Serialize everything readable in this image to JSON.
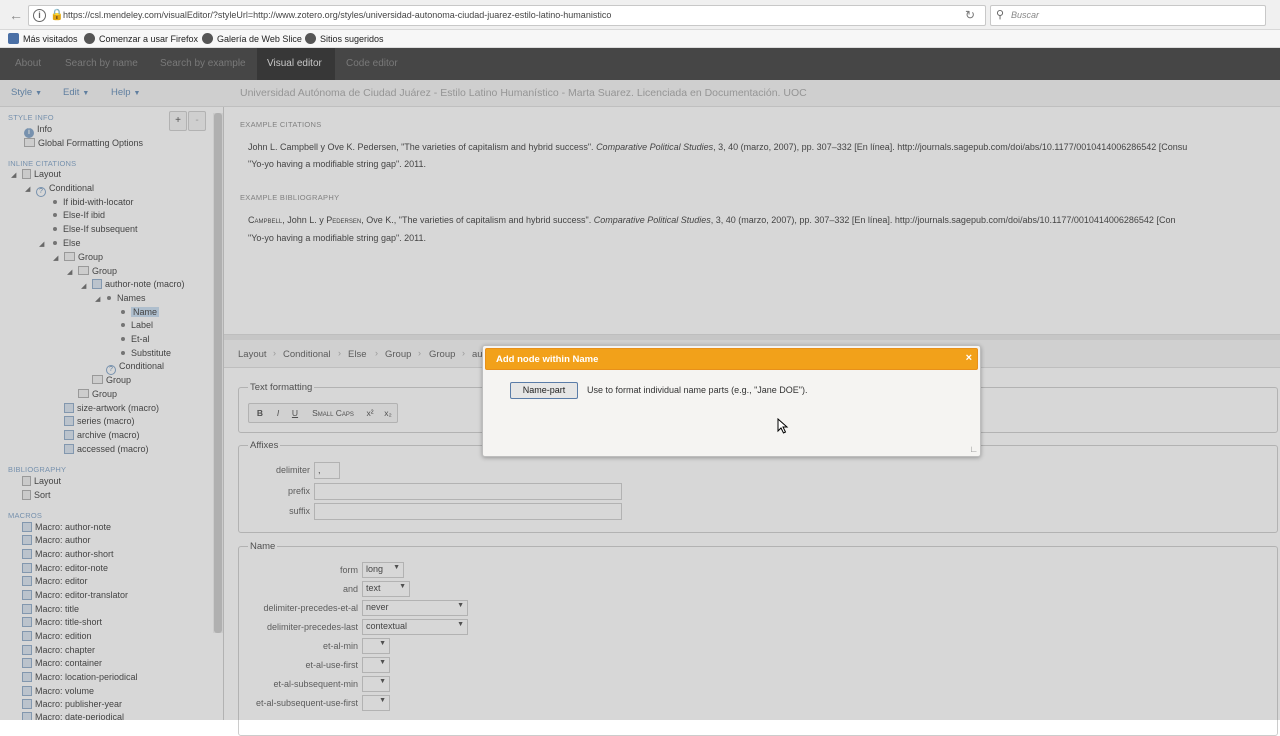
{
  "browser": {
    "url": "https://csl.mendeley.com/visualEditor/?styleUrl=http://www.zotero.org/styles/universidad-autonoma-ciudad-juarez-estilo-latino-humanistico",
    "search_placeholder": "Buscar",
    "bookmarks": [
      "Más visitados",
      "Comenzar a usar Firefox",
      "Galería de Web Slice",
      "Sitios sugeridos"
    ]
  },
  "nav": {
    "items": [
      "About",
      "Search by name",
      "Search by example",
      "Visual editor",
      "Code editor"
    ],
    "active": "Visual editor"
  },
  "menubar": {
    "menus": [
      "Style",
      "Edit",
      "Help"
    ],
    "style_title": "Universidad Autónoma de Ciudad Juárez - Estilo Latino Humanístico - Marta Suarez. Licenciada en Documentación. UOC"
  },
  "sidebar": {
    "add_label": "+",
    "remove_label": "-",
    "style_info_head": "STYLE INFO",
    "info": "Info",
    "global_formatting": "Global Formatting Options",
    "inline_head": "INLINE CITATIONS",
    "inline_nodes": [
      "Layout",
      "Conditional",
      "If ibid-with-locator",
      "Else-If ibid",
      "Else-If subsequent",
      "Else",
      "Group",
      "Group",
      "author-note (macro)",
      "Names",
      "Name",
      "Label",
      "Et-al",
      "Substitute",
      "Conditional",
      "Group",
      "Group",
      "size-artwork (macro)",
      "series (macro)",
      "archive (macro)",
      "accessed (macro)"
    ],
    "bibliography_head": "BIBLIOGRAPHY",
    "bib_nodes": [
      "Layout",
      "Sort"
    ],
    "macros_head": "MACROS",
    "macros": [
      "Macro: author-note",
      "Macro: author",
      "Macro: author-short",
      "Macro: editor-note",
      "Macro: editor",
      "Macro: editor-translator",
      "Macro: title",
      "Macro: title-short",
      "Macro: edition",
      "Macro: chapter",
      "Macro: container",
      "Macro: location-periodical",
      "Macro: volume",
      "Macro: publisher-year",
      "Macro: date-periodical"
    ]
  },
  "preview": {
    "citations_head": "EXAMPLE CITATIONS",
    "citation_1_a": "John L. Campbell y Ove K. Pedersen, \"The varieties of capitalism and hybrid success\". ",
    "citation_1_i": "Comparative Political Studies",
    "citation_1_b": ", 3, 40 (marzo, 2007), pp. 307–332 [En línea]. http://journals.sagepub.com/doi/abs/10.1177/0010414006286542 [Consu",
    "citation_2": "\"Yo-yo having a modifiable string gap\". 2011.",
    "bibliography_head": "EXAMPLE BIBLIOGRAPHY",
    "bib_1_sc1": "Campbell",
    "bib_1_a": ", John L. y ",
    "bib_1_sc2": "Pedersen",
    "bib_1_b": ", Ove K., \"The varieties of capitalism and hybrid success\". ",
    "bib_1_i": "Comparative Political Studies",
    "bib_1_c": ", 3, 40 (marzo, 2007), pp. 307–332 [En línea]. http://journals.sagepub.com/doi/abs/10.1177/0010414006286542 [Con",
    "bib_2": "\"Yo-yo having a modifiable string gap\". 2011."
  },
  "breadcrumb": [
    "Layout",
    "Conditional",
    "Else",
    "Group",
    "Group",
    "au"
  ],
  "editor": {
    "text_formatting": "Text formatting",
    "fmt_buttons": [
      "B",
      "I",
      "U",
      "Small Caps",
      "x²",
      "x₂"
    ],
    "affixes": "Affixes",
    "delimiter_label": "delimiter",
    "delimiter_value": ",",
    "prefix_label": "prefix",
    "prefix_value": "",
    "suffix_label": "suffix",
    "suffix_value": "",
    "name_legend": "Name",
    "fields": [
      {
        "label": "form",
        "value": "long"
      },
      {
        "label": "and",
        "value": "text"
      },
      {
        "label": "delimiter-precedes-et-al",
        "value": "never"
      },
      {
        "label": "delimiter-precedes-last",
        "value": "contextual"
      },
      {
        "label": "et-al-min",
        "value": ""
      },
      {
        "label": "et-al-use-first",
        "value": ""
      },
      {
        "label": "et-al-subsequent-min",
        "value": ""
      },
      {
        "label": "et-al-subsequent-use-first",
        "value": ""
      }
    ]
  },
  "dialog": {
    "title": "Add node within Name",
    "close": "×",
    "button": "Name-part",
    "description": "Use to format individual name parts (e.g., \"Jane DOE\")."
  },
  "colors": {
    "accent": "#f2a11a",
    "nav_bg": "#363636",
    "link": "#5b86b3"
  }
}
